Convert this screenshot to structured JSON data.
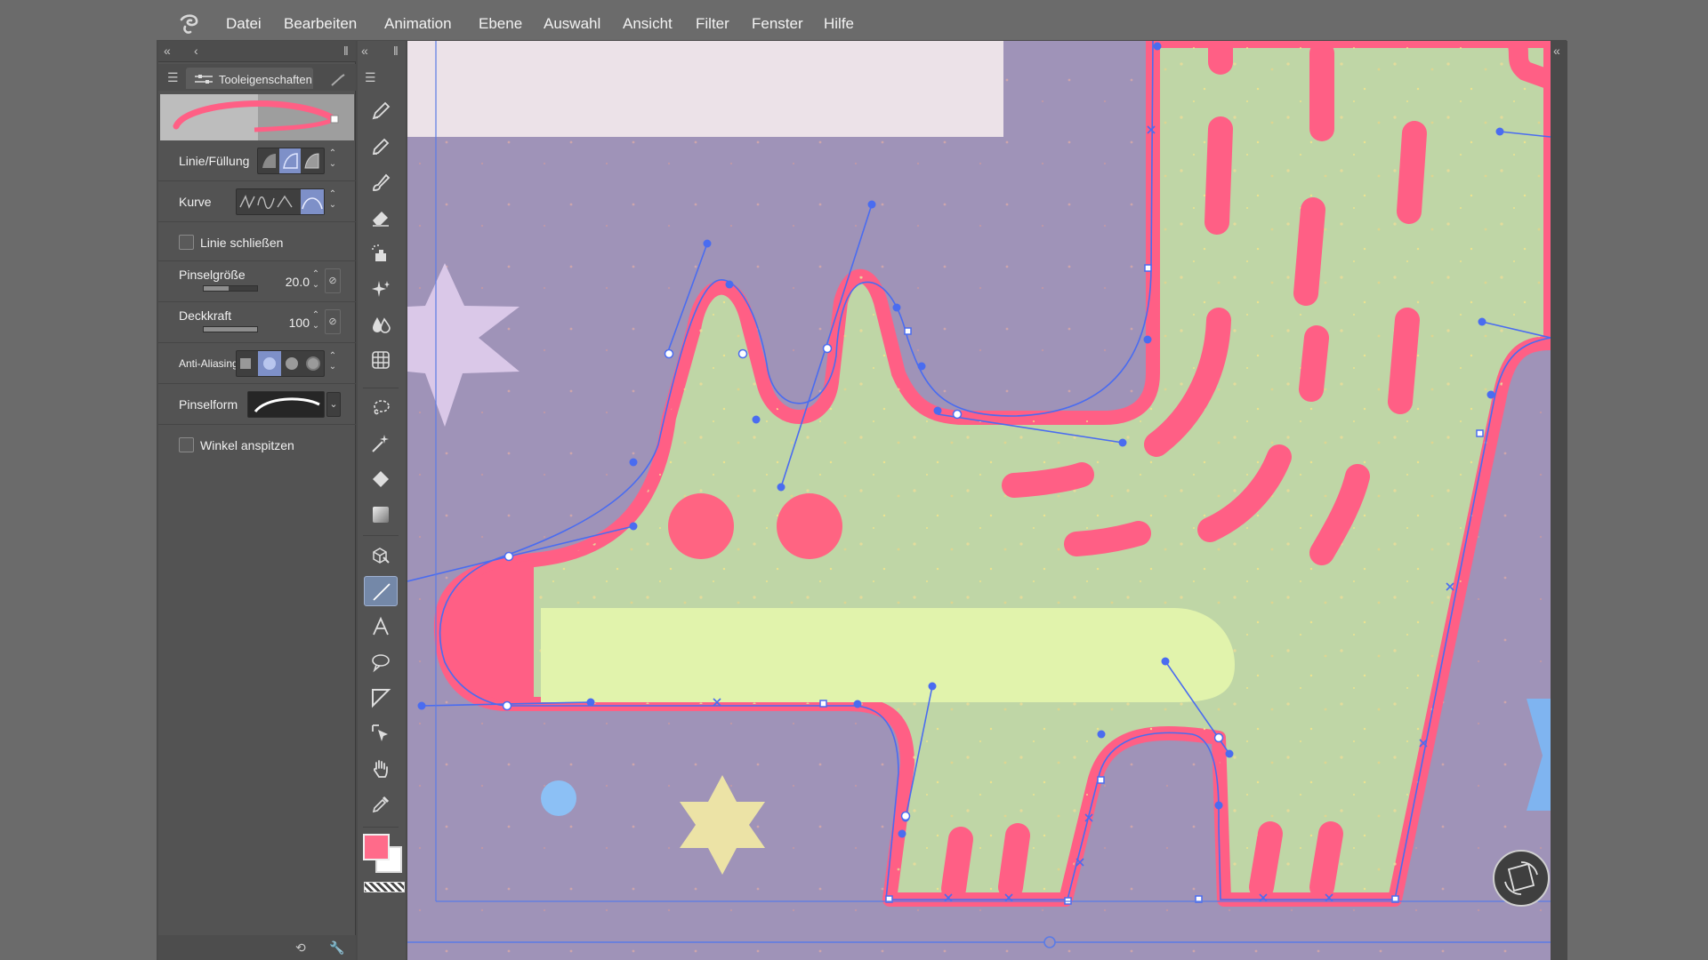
{
  "menu": {
    "items": [
      "Datei",
      "Bearbeiten",
      "Animation",
      "Ebene",
      "Auswahl",
      "Ansicht",
      "Filter",
      "Fenster",
      "Hilfe"
    ]
  },
  "tool_properties": {
    "tab_label": "Tooleigenschaften",
    "line_fill_label": "Linie/Füllung",
    "curve_label": "Kurve",
    "close_line_label": "Linie schließen",
    "close_line_checked": false,
    "brush_size_label": "Pinselgröße",
    "brush_size_value": "20.0",
    "opacity_label": "Deckkraft",
    "opacity_value": "100",
    "antialiasing_label": "Anti-Aliasing",
    "brush_shape_label": "Pinselform",
    "sharpen_corners_label": "Winkel anspitzen",
    "sharpen_corners_checked": false
  },
  "colors": {
    "main": "#ff6b8a",
    "sub": "#ffffff",
    "canvas_bg": "#9f93b8",
    "creature_fill": "#bfd6a6",
    "accent_pink": "#ff5f85",
    "vector_blue": "#4a6cf0",
    "selected_tool": "#7488a8"
  },
  "icons": {
    "app_logo": "clip-studio-logo-icon",
    "tools": [
      "pen-icon",
      "pencil-icon",
      "brush-icon",
      "eraser-icon",
      "airbrush-icon",
      "decoration-icon",
      "blend-icon",
      "grid-icon",
      "lasso-icon",
      "magic-wand-icon",
      "fill-bucket-icon",
      "gradient-icon",
      "3d-object-icon",
      "line-figure-icon",
      "text-icon",
      "balloon-icon",
      "frame-border-icon",
      "object-select-icon",
      "hand-icon",
      "eyedropper-icon"
    ],
    "canvas_rotate": "rotate-canvas-icon"
  }
}
